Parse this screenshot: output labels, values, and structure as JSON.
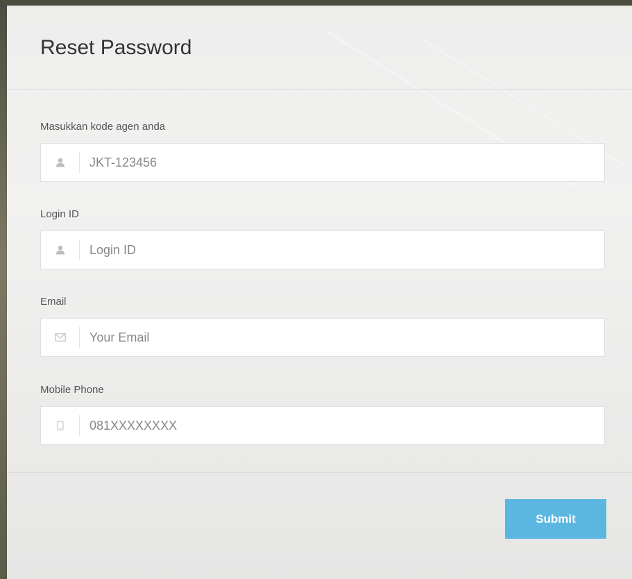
{
  "form": {
    "title": "Reset Password",
    "fields": [
      {
        "label": "Masukkan kode agen anda",
        "icon": "user-icon",
        "value": "",
        "placeholder": "JKT-123456"
      },
      {
        "label": "Login ID",
        "icon": "user-icon",
        "value": "",
        "placeholder": "Login ID"
      },
      {
        "label": "Email",
        "icon": "envelope-icon",
        "value": "",
        "placeholder": "Your Email"
      },
      {
        "label": "Mobile Phone",
        "icon": "mobile-phone-icon",
        "value": "",
        "placeholder": "081XXXXXXXX"
      }
    ],
    "submit_label": "Submit"
  },
  "colors": {
    "submit_button_bg": "#5bb7e0",
    "panel_bg": "#efefee",
    "text": "#333333"
  }
}
